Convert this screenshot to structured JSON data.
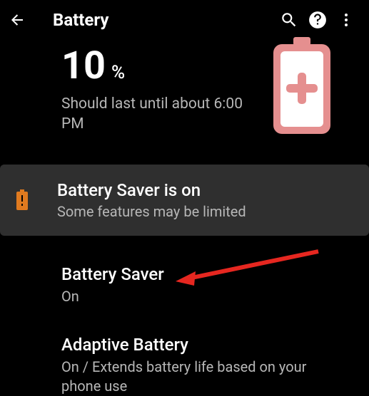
{
  "header": {
    "title": "Battery"
  },
  "summary": {
    "percent_value": "10",
    "percent_sign": "%",
    "estimate": "Should last until about 6:00 PM"
  },
  "banner": {
    "title": "Battery Saver is on",
    "subtitle": "Some features may be limited"
  },
  "items": {
    "saver": {
      "title": "Battery Saver",
      "subtitle": "On"
    },
    "adaptive": {
      "title": "Adaptive Battery",
      "subtitle": "On / Extends battery life based on your phone use"
    }
  },
  "colors": {
    "accent_orange": "#e07a1f",
    "battery_pink": "#e58f8f",
    "arrow_red": "#e62720"
  }
}
